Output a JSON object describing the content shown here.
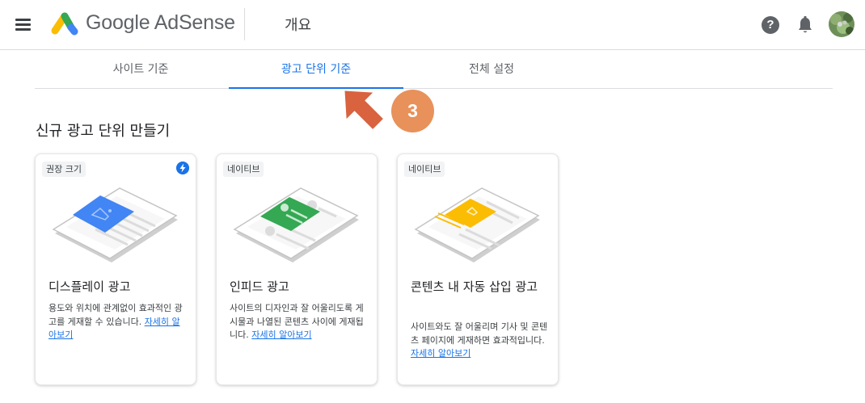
{
  "header": {
    "brand": "Google AdSense",
    "page_title": "개요",
    "help_glyph": "?"
  },
  "tabs": [
    {
      "label": "사이트 기준",
      "active": false
    },
    {
      "label": "광고 단위 기준",
      "active": true
    },
    {
      "label": "전체 설정",
      "active": false
    }
  ],
  "annotation": {
    "badge": "3",
    "color": "#e8915a",
    "arrow_color": "#d9623f"
  },
  "section_title": "신규 광고 단위 만들기",
  "cards": [
    {
      "badge": "권장 크기",
      "has_bolt_icon": true,
      "title": "디스플레이 광고",
      "description": "용도와 위치에 관계없이 효과적인 광고를 게재할 수 있습니다.",
      "link": "자세히 알아보기",
      "accent": "#4285f4"
    },
    {
      "badge": "네이티브",
      "has_bolt_icon": false,
      "title": "인피드 광고",
      "description": "사이트의 디자인과 잘 어울리도록 게시물과 나열된 콘텐츠 사이에 게재됩니다.",
      "link": "자세히 알아보기",
      "accent": "#34a853"
    },
    {
      "badge": "네이티브",
      "has_bolt_icon": false,
      "title": "콘텐츠 내 자동 삽입 광고",
      "description": "사이트와도 잘 어울리며 기사 및 콘텐츠 페이지에 게재하면 효과적입니다.",
      "link": "자세히 알아보기",
      "accent": "#fbbc04"
    }
  ],
  "colors": {
    "primary": "#1a73e8",
    "text": "#202124",
    "muted": "#5f6368",
    "divider": "#dadce0"
  }
}
